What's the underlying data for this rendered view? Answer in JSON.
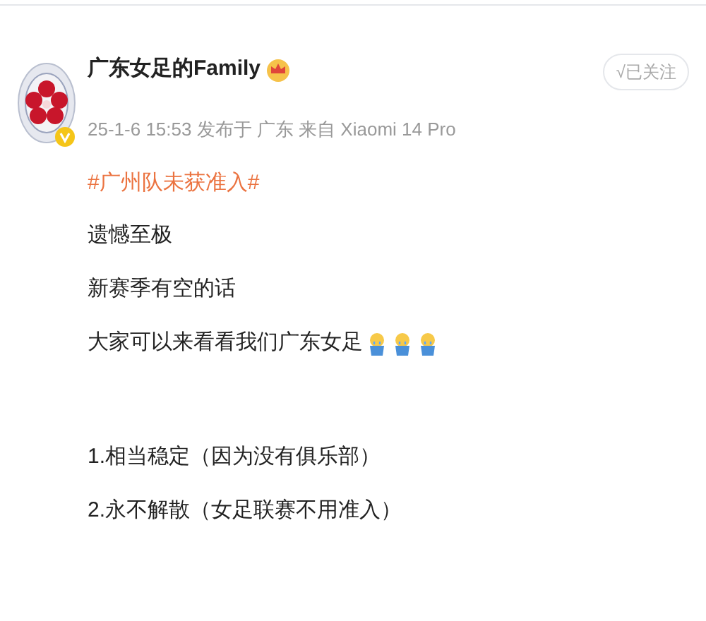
{
  "author": {
    "name": "广东女足的Family",
    "verified": true
  },
  "meta": "25-1-6 15:53 发布于 广东 来自 Xiaomi 14 Pro",
  "follow_button": {
    "label": "√已关注"
  },
  "hashtag": "#广州队未获准入#",
  "lines": [
    {
      "text": "遗憾至极"
    },
    {
      "text": "新赛季有空的话"
    },
    {
      "text": "大家可以来看看我们广东女足",
      "trailing_emojis": [
        {
          "kind": "cry"
        },
        {
          "kind": "cry"
        },
        {
          "kind": "cry"
        }
      ]
    }
  ],
  "list_items": [
    "1.相当稳定（因为没有俱乐部）",
    "2.永不解散（女足联赛不用准入）"
  ]
}
